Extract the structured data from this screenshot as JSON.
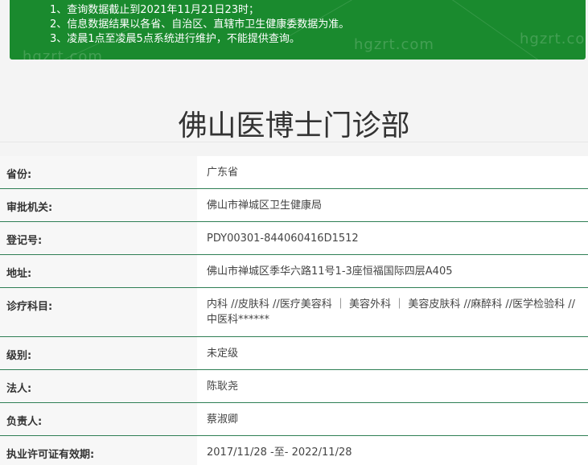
{
  "notice": {
    "lines": [
      "1、查询数据截止到2021年11月21日23时；",
      "2、信息数据结果以各省、自治区、直辖市卫生健康委数据为准。",
      "3、凌晨1点至凌晨5点系统进行维护，不能提供查询。"
    ],
    "watermarks": [
      "hgzrt.com",
      "hgzrt.com",
      "hgzrt.co"
    ],
    "background_color": "#1a8a2e"
  },
  "page": {
    "title": "佛山医博士门诊部"
  },
  "info": {
    "rows": [
      {
        "label": "省份:",
        "value": "广东省"
      },
      {
        "label": "审批机关:",
        "value": "佛山市禅城区卫生健康局"
      },
      {
        "label": "登记号:",
        "value": "PDY00301-844060416D1512"
      },
      {
        "label": "地址:",
        "value": "佛山市禅城区季华六路11号1-3座恒福国际四层A405"
      },
      {
        "label": "诊疗科目:",
        "value": "内科 //皮肤科 //医疗美容科 ｜ 美容外科 ｜ 美容皮肤科 //麻醉科 //医学检验科 //中医科******"
      },
      {
        "label": "级别:",
        "value": "未定级"
      },
      {
        "label": "法人:",
        "value": "陈耿尧"
      },
      {
        "label": "负责人:",
        "value": "蔡淑卿"
      },
      {
        "label": "执业许可证有效期:",
        "value": "2017/11/28 -至- 2022/11/28"
      }
    ],
    "border_color": "#2f7f55"
  }
}
